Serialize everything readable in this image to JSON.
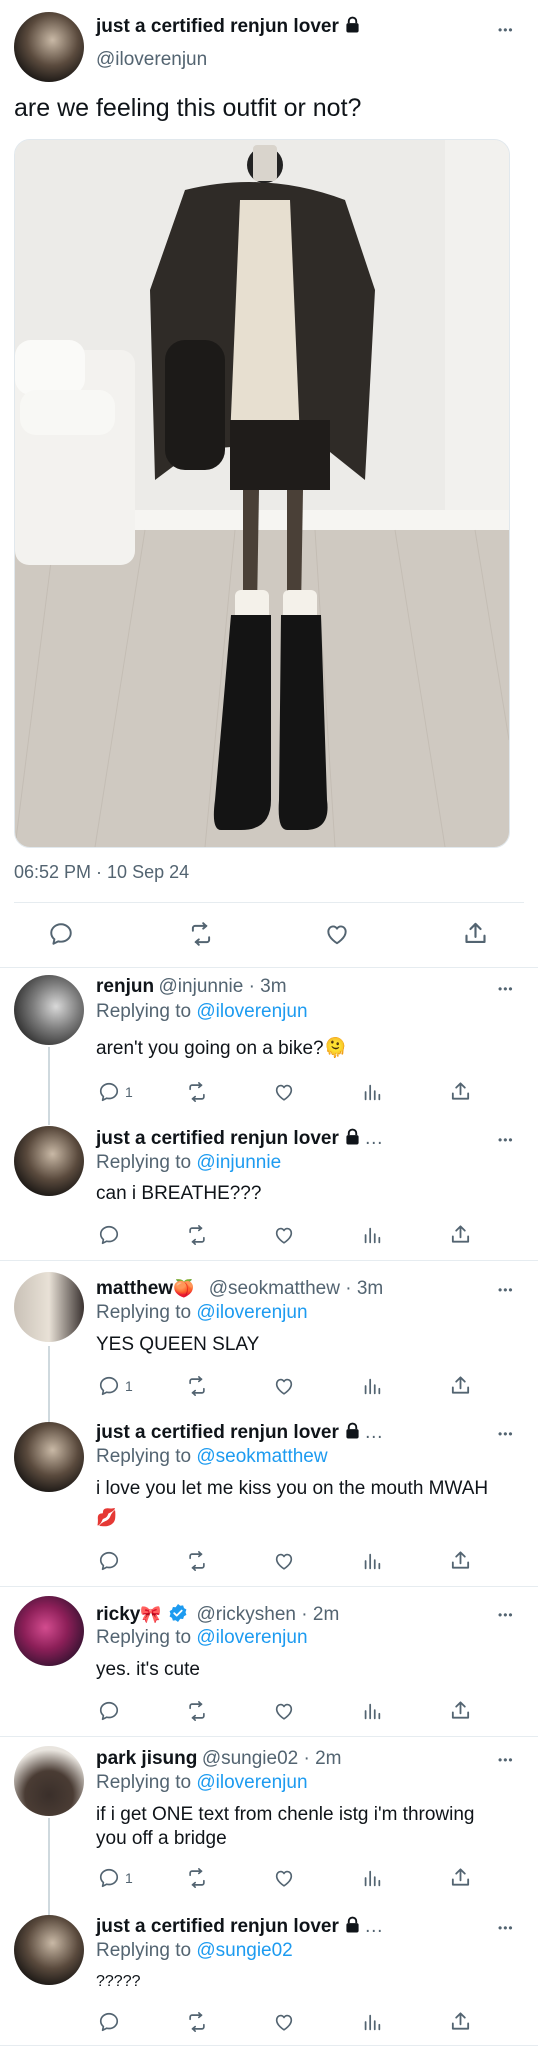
{
  "main_tweet": {
    "display_name": "just a certified renjun lover",
    "handle": "@iloverenjun",
    "text": "are we feeling this outfit or not?",
    "timestamp": "06:52 PM · 10 Sep 24",
    "more": "•••"
  },
  "replies": [
    {
      "display_name": "renjun",
      "handle": "@injunnie · 3m",
      "replying_prefix": "Replying to",
      "replying_to": "@iloverenjun",
      "text": "aren't you going on a bike?",
      "emoji": "🫠",
      "reply_count": "1"
    },
    {
      "display_name": "just a certified renjun lover",
      "handle": "…",
      "replying_prefix": "Replying to",
      "replying_to": "@injunnie",
      "text": "can i BREATHE???"
    },
    {
      "display_name": "matthew",
      "emoji_name": "🍑",
      "handle": "@seokmatthew · 3m",
      "replying_prefix": "Replying to",
      "replying_to": "@iloverenjun",
      "text": "YES QUEEN SLAY",
      "reply_count": "1"
    },
    {
      "display_name": "just a certified renjun lover",
      "handle": "…",
      "replying_prefix": "Replying to",
      "replying_to": "@seokmatthew",
      "text": "i love you let me kiss you on the mouth MWAH",
      "text_line2": "💋"
    },
    {
      "display_name": "ricky",
      "emoji_name": "🎀",
      "handle": "@rickyshen · 2m",
      "replying_prefix": "Replying to",
      "replying_to": "@iloverenjun",
      "text": "yes. it's cute"
    },
    {
      "display_name": "park jisung",
      "handle": "@sungie02 · 2m",
      "replying_prefix": "Replying to",
      "replying_to": "@iloverenjun",
      "text": "if i get ONE text from chenle istg i'm throwing",
      "text_line2": "you off a bridge",
      "reply_count": "1"
    },
    {
      "display_name": "just a certified renjun lover",
      "handle": "…",
      "replying_prefix": "Replying to",
      "replying_to": "@sungie02",
      "text": "?????"
    }
  ],
  "colors": {
    "accent": "#1d9bf0",
    "secondary_text": "#536471",
    "divider": "#e6ecf0",
    "verified": "#1d9bf0"
  },
  "icons": [
    "lock-icon",
    "reply-icon",
    "retweet-icon",
    "like-icon",
    "views-icon",
    "share-icon",
    "verified-badge-icon",
    "more-icon"
  ]
}
